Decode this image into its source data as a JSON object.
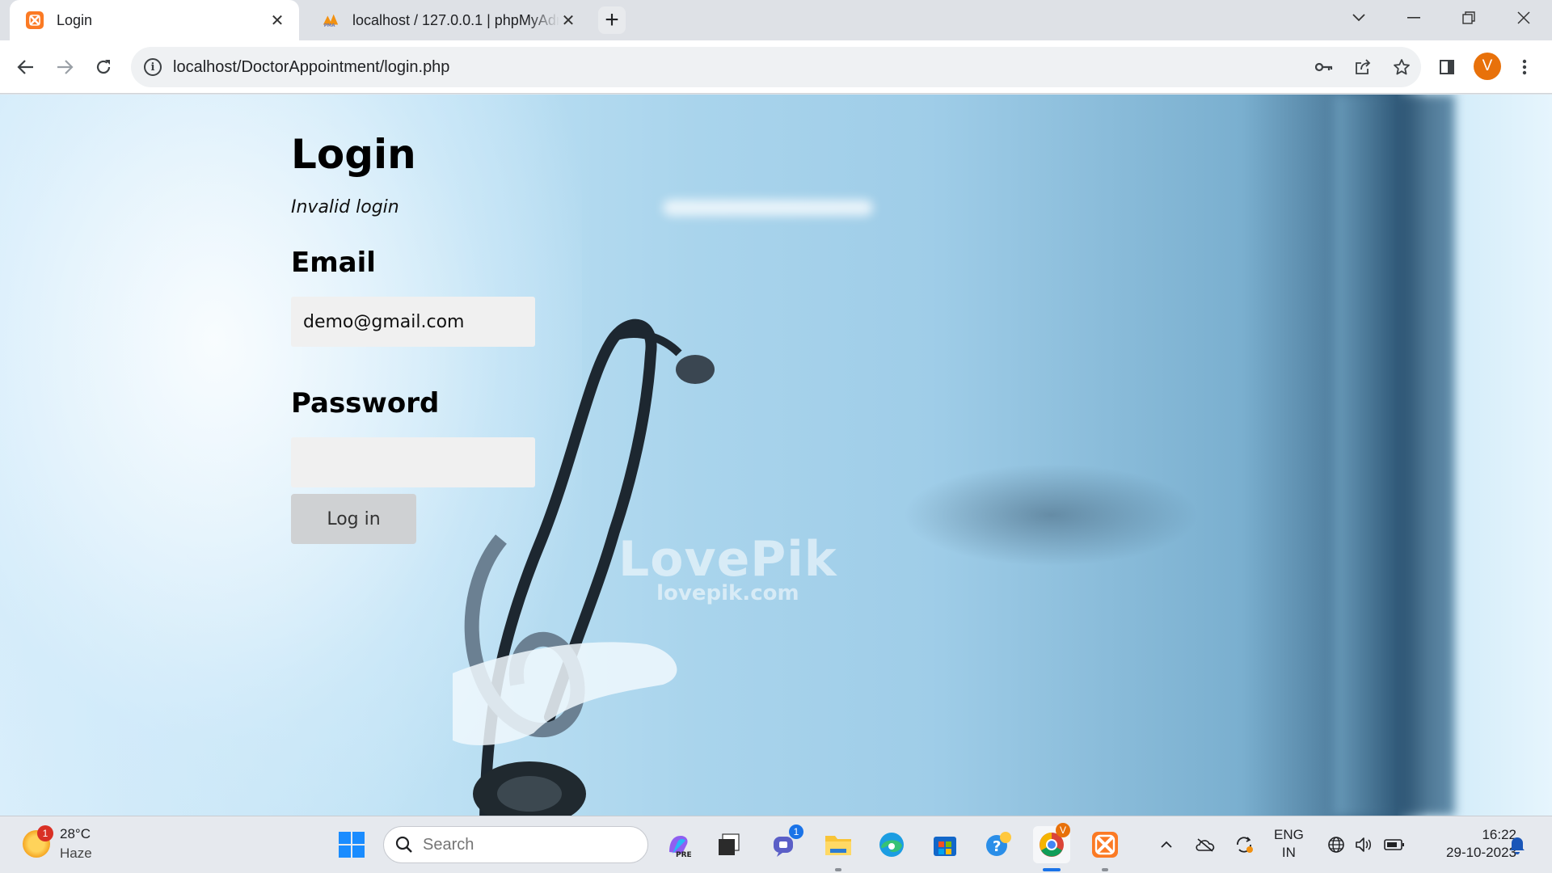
{
  "browser": {
    "tabs": [
      {
        "title": "Login",
        "active": true
      },
      {
        "title": "localhost / 127.0.0.1 | phpMyAdmin",
        "active": false
      }
    ],
    "address_url": "localhost/DoctorAppointment/login.php",
    "profile_initial": "V"
  },
  "page": {
    "heading": "Login",
    "error_message": "Invalid login",
    "email_label": "Email",
    "email_value": "demo@gmail.com",
    "password_label": "Password",
    "password_value": "",
    "login_button": "Log in",
    "watermark_main": "LovePik",
    "watermark_sub": "lovepik.com"
  },
  "taskbar": {
    "weather": {
      "badge": "1",
      "temp": "28°C",
      "condition": "Haze"
    },
    "search_placeholder": "Search",
    "teams_badge": "1",
    "chrome_badge": "V",
    "language_top": "ENG",
    "language_bottom": "IN",
    "time": "16:22",
    "date": "29-10-2023"
  },
  "colors": {
    "xampp_orange": "#fb7a24",
    "profile_orange": "#e8710a",
    "input_bg": "#f0f0f0",
    "button_bg": "#cfd1d3"
  }
}
